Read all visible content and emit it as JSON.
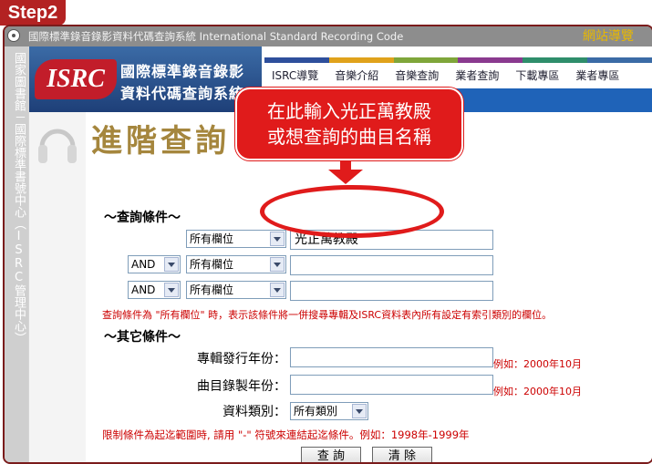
{
  "step_badge": "Step2",
  "titlebar": {
    "text": "國際標準錄音錄影資料代碼查詢系統 International Standard Recording Code",
    "nav_label": "網站導覽"
  },
  "sidebar_vertical_text": "國家圖書館－國際標準書號中心（ISRC管理中心）",
  "logo": {
    "mark": "ISRC",
    "line1": "國際標準錄音錄影",
    "line2": "資料代碼查詢系統"
  },
  "menu": {
    "items": [
      "ISRC導覽",
      "音樂介紹",
      "音樂查詢",
      "業者查詢",
      "下載專區",
      "業者專區"
    ],
    "colors": [
      "#2e4f9c",
      "#e0a21b",
      "#7fa63a",
      "#8a3a8f",
      "#2f8e6b",
      "#3b6ba6"
    ]
  },
  "page_title": "進階查詢",
  "callout": {
    "line1": "在此輸入光正萬教殿",
    "line2": "或想查詢的曲目名稱"
  },
  "query": {
    "section_title": "～查詢條件～",
    "rows": [
      {
        "operator": "",
        "field": "所有欄位",
        "value": "光正萬教殿"
      },
      {
        "operator": "AND",
        "field": "所有欄位",
        "value": ""
      },
      {
        "operator": "AND",
        "field": "所有欄位",
        "value": ""
      }
    ],
    "note": "查詢條件為 \"所有欄位\" 時，表示該條件將一併搜尋專輯及ISRC資料表內所有設定有索引類別的欄位。"
  },
  "other": {
    "section_title": "～其它條件～",
    "release_year_label": "專輯發行年份：",
    "release_year_example": "例如：2000年10月",
    "record_year_label": "曲目錄製年份：",
    "record_year_example": "例如：2000年10月",
    "type_label": "資料類別：",
    "type_value": "所有類別",
    "range_note": "限制條件為起迄範圍時, 請用 \"-\" 符號來連結起迄條件。例如：1998年-1999年"
  },
  "buttons": {
    "search": "查 詢",
    "clear": "清 除"
  }
}
